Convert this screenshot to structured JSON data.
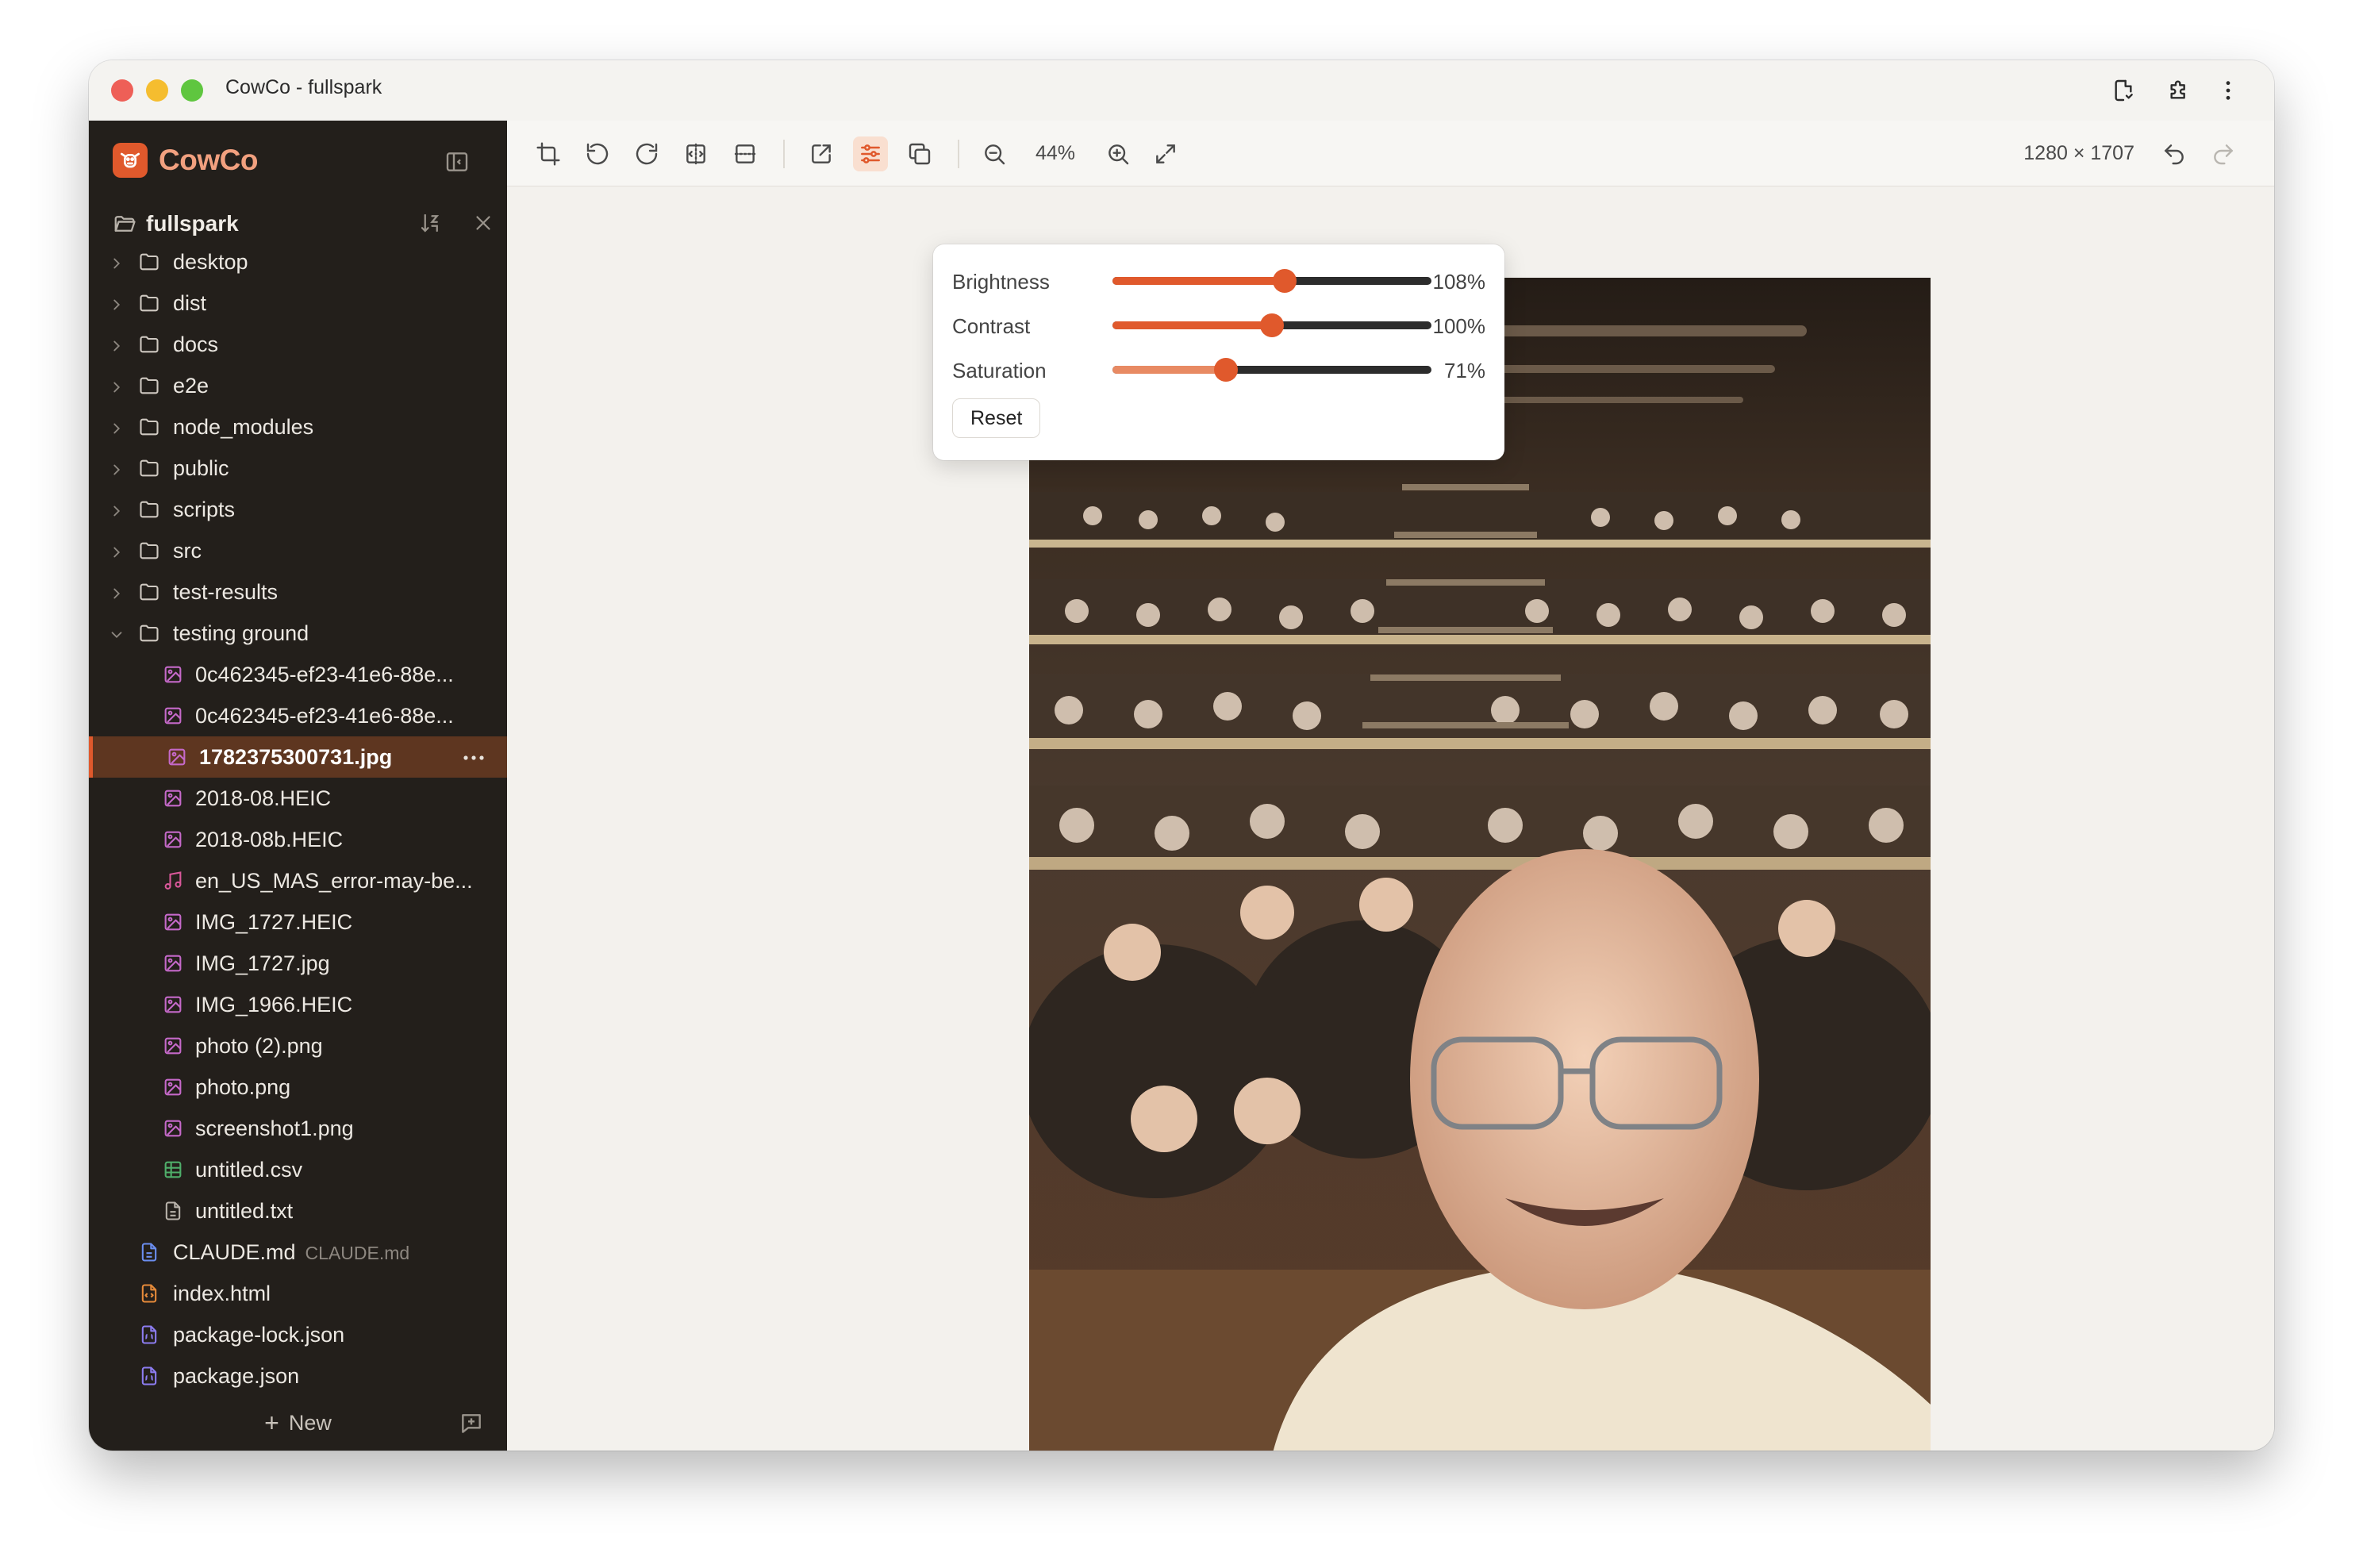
{
  "window": {
    "title": "CowCo - fullspark"
  },
  "sidebar": {
    "brand": "CowCo",
    "root": {
      "name": "fullspark"
    },
    "folders": [
      {
        "label": "desktop",
        "expanded": false
      },
      {
        "label": "dist",
        "expanded": false
      },
      {
        "label": "docs",
        "expanded": false
      },
      {
        "label": "e2e",
        "expanded": false
      },
      {
        "label": "node_modules",
        "expanded": false
      },
      {
        "label": "public",
        "expanded": false
      },
      {
        "label": "scripts",
        "expanded": false
      },
      {
        "label": "src",
        "expanded": false
      },
      {
        "label": "test-results",
        "expanded": false
      },
      {
        "label": "testing ground",
        "expanded": true
      }
    ],
    "testing_ground_files": [
      {
        "label": "0c462345-ef23-41e6-88e...",
        "icon": "image-file-icon"
      },
      {
        "label": "0c462345-ef23-41e6-88e...",
        "icon": "image-file-icon"
      },
      {
        "label": "1782375300731.jpg",
        "icon": "image-file-icon",
        "selected": true
      },
      {
        "label": "2018-08.HEIC",
        "icon": "image-file-icon"
      },
      {
        "label": "2018-08b.HEIC",
        "icon": "image-file-icon"
      },
      {
        "label": "en_US_MAS_error-may-be...",
        "icon": "audio-file-icon"
      },
      {
        "label": "IMG_1727.HEIC",
        "icon": "image-file-icon"
      },
      {
        "label": "IMG_1727.jpg",
        "icon": "image-file-icon"
      },
      {
        "label": "IMG_1966.HEIC",
        "icon": "image-file-icon"
      },
      {
        "label": "photo (2).png",
        "icon": "image-file-icon"
      },
      {
        "label": "photo.png",
        "icon": "image-file-icon"
      },
      {
        "label": "screenshot1.png",
        "icon": "image-file-icon"
      },
      {
        "label": "untitled.csv",
        "icon": "spreadsheet-file-icon"
      },
      {
        "label": "untitled.txt",
        "icon": "text-file-icon"
      }
    ],
    "root_files": [
      {
        "label": "CLAUDE.md",
        "hint": "CLAUDE.md",
        "icon": "document-file-icon"
      },
      {
        "label": "index.html",
        "icon": "code-file-icon"
      },
      {
        "label": "package-lock.json",
        "icon": "json-file-icon"
      },
      {
        "label": "package.json",
        "icon": "json-file-icon"
      }
    ],
    "new_label": "New"
  },
  "toolbar": {
    "zoom": "44%",
    "dimensions": "1280 × 1707"
  },
  "adjustments": {
    "brightness": {
      "label": "Brightness",
      "value_text": "108%",
      "fraction": 0.54
    },
    "contrast": {
      "label": "Contrast",
      "value_text": "100%",
      "fraction": 0.5
    },
    "saturation": {
      "label": "Saturation",
      "value_text": "71%",
      "fraction": 0.355
    },
    "reset_label": "Reset"
  },
  "colors": {
    "accent": "#e0592c",
    "sidebar_bg": "#231f1b",
    "selected_row": "#5e3620",
    "brand_text": "#f1a07f"
  }
}
